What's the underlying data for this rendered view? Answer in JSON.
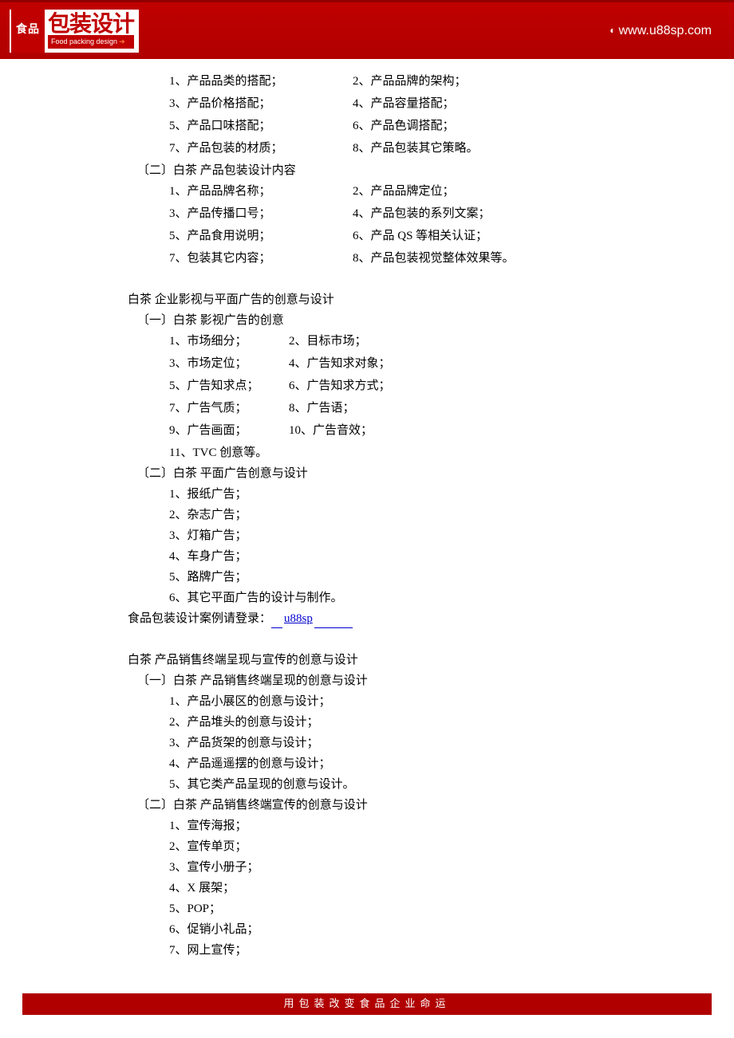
{
  "header": {
    "logo_food": "食品",
    "logo_cn": "包装设计",
    "logo_en": "Food packing design",
    "url": "www.u88sp.com"
  },
  "section1": {
    "listA": [
      [
        "1、产品品类的搭配；",
        "2、产品品牌的架构；"
      ],
      [
        "3、产品价格搭配；",
        "4、产品容量搭配；"
      ],
      [
        "5、产品口味搭配；",
        "6、产品色调搭配；"
      ],
      [
        "7、产品包装的材质；",
        "8、产品包装其它策略。"
      ]
    ],
    "sub2": "〔二〕白茶  产品包装设计内容",
    "listB": [
      [
        "1、产品品牌名称；",
        "2、产品品牌定位；"
      ],
      [
        "3、产品传播口号；",
        "4、产品包装的系列文案；"
      ],
      [
        "5、产品食用说明；",
        "6、产品 QS 等相关认证；"
      ],
      [
        "7、包装其它内容；",
        "8、产品包装视觉整体效果等。"
      ]
    ]
  },
  "section2": {
    "title": "白茶  企业影视与平面广告的创意与设计",
    "sub1": "〔一〕白茶  影视广告的创意",
    "listA": [
      [
        "1、市场细分；",
        "2、目标市场；"
      ],
      [
        "3、市场定位；",
        "4、广告知求对象；"
      ],
      [
        "5、广告知求点；",
        "6、广告知求方式；"
      ],
      [
        "7、广告气质；",
        "8、广告语；"
      ],
      [
        "9、广告画面；",
        "10、广告音效；"
      ]
    ],
    "listA_last": "11、TVC 创意等。",
    "sub2": "〔二〕白茶  平面广告创意与设计",
    "listB": [
      "1、报纸广告；",
      "2、杂志广告；",
      "3、灯箱广告；",
      "4、车身广告；",
      "5、路牌广告；",
      "6、其它平面广告的设计与制作。"
    ]
  },
  "link_line": {
    "prefix": "食品包装设计案例请登录：",
    "link": "u88sp"
  },
  "section3": {
    "title": "白茶  产品销售终端呈现与宣传的创意与设计",
    "sub1": "〔一〕白茶  产品销售终端呈现的创意与设计",
    "listA": [
      "1、产品小展区的创意与设计；",
      "2、产品堆头的创意与设计；",
      "3、产品货架的创意与设计；",
      "4、产品遥遥摆的创意与设计；",
      "5、其它类产品呈现的创意与设计。"
    ],
    "sub2": "〔二〕白茶  产品销售终端宣传的创意与设计",
    "listB": [
      "1、宣传海报；",
      "2、宣传单页；",
      "3、宣传小册子；",
      "4、X 展架；",
      "5、POP；",
      "6、促销小礼品；",
      "7、网上宣传；"
    ]
  },
  "footer": "用包装改变食品企业命运"
}
